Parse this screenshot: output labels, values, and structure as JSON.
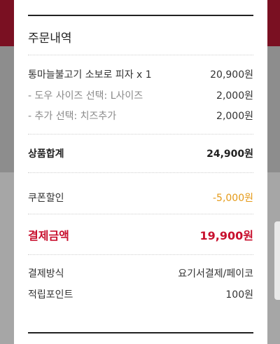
{
  "order": {
    "title": "주문내역",
    "item": {
      "label": "통마늘불고기 소보로 피자 x 1",
      "price": "20,900원"
    },
    "options": [
      {
        "label": "- 도우 사이즈 선택: L사이즈",
        "price": "2,000원"
      },
      {
        "label": "- 추가 선택: 치즈추가",
        "price": "2,000원"
      }
    ],
    "subtotal": {
      "label": "상품합계",
      "value": "24,900원"
    },
    "coupon": {
      "label": "쿠폰할인",
      "value": "-5,000원"
    },
    "total": {
      "label": "결제금액",
      "value": "19,900원"
    },
    "payment_method": {
      "label": "결제방식",
      "value": "요기서결제/페이코"
    },
    "points": {
      "label": "적립포인트",
      "value": "100원"
    }
  },
  "colors": {
    "accent": "#c8102e",
    "discount": "#e59a18",
    "header_bg": "#7a1022"
  }
}
